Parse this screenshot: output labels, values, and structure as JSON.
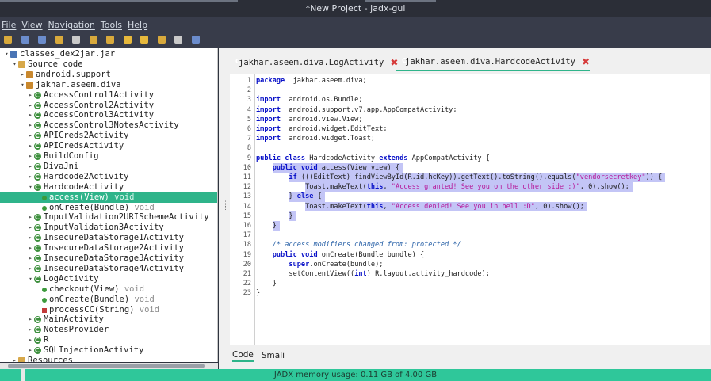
{
  "window": {
    "title": "*New Project - jadx-gui"
  },
  "menu": [
    "File",
    "View",
    "Navigation",
    "Tools",
    "Help"
  ],
  "toolbar": {
    "icons": [
      {
        "name": "open-file-icon",
        "color": "#d8a93c"
      },
      {
        "name": "add-files-icon",
        "color": "#6b8ccc"
      },
      {
        "name": "save-all-icon",
        "color": "#6b8ccc"
      },
      {
        "name": "sync-tree-icon",
        "color": "#d8a93c"
      },
      {
        "name": "flatten-packages-icon",
        "color": "#c9c9c9"
      },
      {
        "name": "text-search-icon",
        "color": "#d8a93c"
      },
      {
        "name": "class-search-icon",
        "color": "#d8a93c"
      },
      {
        "name": "back-icon",
        "color": "#e6b83c"
      },
      {
        "name": "forward-icon",
        "color": "#e6b83c"
      },
      {
        "name": "decompile-all-icon",
        "color": "#d8a93c"
      },
      {
        "name": "log-viewer-icon",
        "color": "#c9c9c9"
      },
      {
        "name": "preferences-icon",
        "color": "#6b8ccc"
      }
    ]
  },
  "tree": {
    "rows": [
      {
        "label": "classes_dex2jar.jar",
        "indent": 0,
        "arrow": "▾",
        "icon": "jar"
      },
      {
        "label": "Source code",
        "indent": 1,
        "arrow": "▾",
        "icon": "folder"
      },
      {
        "label": "android.support",
        "indent": 2,
        "arrow": "▸",
        "icon": "pkg"
      },
      {
        "label": "jakhar.aseem.diva",
        "indent": 2,
        "arrow": "▾",
        "icon": "pkg"
      },
      {
        "label": "AccessControl1Activity",
        "indent": 3,
        "arrow": "▸",
        "icon": "class"
      },
      {
        "label": "AccessControl2Activity",
        "indent": 3,
        "arrow": "▸",
        "icon": "class"
      },
      {
        "label": "AccessControl3Activity",
        "indent": 3,
        "arrow": "▸",
        "icon": "class"
      },
      {
        "label": "AccessControl3NotesActivity",
        "indent": 3,
        "arrow": "▸",
        "icon": "class"
      },
      {
        "label": "APICreds2Activity",
        "indent": 3,
        "arrow": "▸",
        "icon": "class"
      },
      {
        "label": "APICredsActivity",
        "indent": 3,
        "arrow": "▸",
        "icon": "class"
      },
      {
        "label": "BuildConfig",
        "indent": 3,
        "arrow": "▸",
        "icon": "class"
      },
      {
        "label": "DivaJni",
        "indent": 3,
        "arrow": "▸",
        "icon": "class"
      },
      {
        "label": "Hardcode2Activity",
        "indent": 3,
        "arrow": "▸",
        "icon": "class"
      },
      {
        "label": "HardcodeActivity",
        "indent": 3,
        "arrow": "▾",
        "icon": "class"
      },
      {
        "label": "access(View)",
        "rtype": "void",
        "indent": 4,
        "arrow": "",
        "icon": "method",
        "selected": true
      },
      {
        "label": "onCreate(Bundle)",
        "rtype": "void",
        "indent": 4,
        "arrow": "",
        "icon": "method"
      },
      {
        "label": "InputValidation2URISchemeActivity",
        "indent": 3,
        "arrow": "▸",
        "icon": "class"
      },
      {
        "label": "InputValidation3Activity",
        "indent": 3,
        "arrow": "▸",
        "icon": "class"
      },
      {
        "label": "InsecureDataStorage1Activity",
        "indent": 3,
        "arrow": "▸",
        "icon": "class"
      },
      {
        "label": "InsecureDataStorage2Activity",
        "indent": 3,
        "arrow": "▸",
        "icon": "class"
      },
      {
        "label": "InsecureDataStorage3Activity",
        "indent": 3,
        "arrow": "▸",
        "icon": "class"
      },
      {
        "label": "InsecureDataStorage4Activity",
        "indent": 3,
        "arrow": "▸",
        "icon": "class"
      },
      {
        "label": "LogActivity",
        "indent": 3,
        "arrow": "▾",
        "icon": "class"
      },
      {
        "label": "checkout(View)",
        "rtype": "void",
        "indent": 4,
        "arrow": "",
        "icon": "method"
      },
      {
        "label": "onCreate(Bundle)",
        "rtype": "void",
        "indent": 4,
        "arrow": "",
        "icon": "method"
      },
      {
        "label": "processCC(String)",
        "rtype": "void",
        "indent": 4,
        "arrow": "",
        "icon": "method-priv"
      },
      {
        "label": "MainActivity",
        "indent": 3,
        "arrow": "▸",
        "icon": "class"
      },
      {
        "label": "NotesProvider",
        "indent": 3,
        "arrow": "▸",
        "icon": "class"
      },
      {
        "label": "R",
        "indent": 3,
        "arrow": "▸",
        "icon": "class"
      },
      {
        "label": "SQLInjectionActivity",
        "indent": 3,
        "arrow": "▸",
        "icon": "class"
      },
      {
        "label": "Resources",
        "indent": 1,
        "arrow": "▸",
        "icon": "folder"
      }
    ]
  },
  "editor": {
    "tabs": [
      {
        "label": "jakhar.aseem.diva.LogActivity",
        "active": false
      },
      {
        "label": "jakhar.aseem.diva.HardcodeActivity",
        "active": true
      }
    ],
    "bottom_tabs": [
      {
        "label": "Code",
        "active": true
      },
      {
        "label": "Smali",
        "active": false
      }
    ],
    "lines": [
      {
        "n": "1",
        "t": [
          [
            "kw",
            "package"
          ],
          [
            "",
            "  jakhar.aseem.diva;"
          ]
        ]
      },
      {
        "n": "2",
        "t": []
      },
      {
        "n": "3",
        "t": [
          [
            "kw",
            "import"
          ],
          [
            "",
            "  android.os.Bundle;"
          ]
        ]
      },
      {
        "n": "4",
        "t": [
          [
            "kw",
            "import"
          ],
          [
            "",
            "  android.support.v7.app.AppCompatActivity;"
          ]
        ]
      },
      {
        "n": "5",
        "t": [
          [
            "kw",
            "import"
          ],
          [
            "",
            "  android.view.View;"
          ]
        ]
      },
      {
        "n": "6",
        "t": [
          [
            "kw",
            "import"
          ],
          [
            "",
            "  android.widget.EditText;"
          ]
        ]
      },
      {
        "n": "7",
        "t": [
          [
            "kw",
            "import"
          ],
          [
            "",
            "  android.widget.Toast;"
          ]
        ]
      },
      {
        "n": "8",
        "t": []
      },
      {
        "n": "9",
        "t": [
          [
            "kw",
            "public class"
          ],
          [
            "",
            " HardcodeActivity "
          ],
          [
            "kw",
            "extends"
          ],
          [
            "",
            " AppCompatActivity {"
          ]
        ]
      },
      {
        "n": "10",
        "t": [
          [
            "",
            "    "
          ],
          [
            "kw",
            "public void"
          ],
          [
            "",
            " access(View view) {"
          ]
        ],
        "sel": true
      },
      {
        "n": "11",
        "t": [
          [
            "",
            "        "
          ],
          [
            "kw",
            "if"
          ],
          [
            "",
            " (((EditText) findViewById(R.id.hcKey)).getText().toString().equals("
          ],
          [
            "str",
            "\"vendorsecretkey\""
          ],
          [
            "",
            ")) {"
          ]
        ],
        "sel": true
      },
      {
        "n": "12",
        "t": [
          [
            "",
            "            Toast.makeText("
          ],
          [
            "kw",
            "this"
          ],
          [
            "",
            ", "
          ],
          [
            "str",
            "\"Access granted! See you on the other side :)\""
          ],
          [
            "",
            ", 0).show();"
          ]
        ],
        "sel": true
      },
      {
        "n": "13",
        "t": [
          [
            "",
            "        } "
          ],
          [
            "kw",
            "else"
          ],
          [
            "",
            " {"
          ]
        ],
        "sel": true
      },
      {
        "n": "14",
        "t": [
          [
            "",
            "            Toast.makeText("
          ],
          [
            "kw",
            "this"
          ],
          [
            "",
            ", "
          ],
          [
            "str",
            "\"Access denied! See you in hell :D\""
          ],
          [
            "",
            ", 0).show();"
          ]
        ],
        "sel": true
      },
      {
        "n": "15",
        "t": [
          [
            "",
            "        }"
          ]
        ],
        "sel": true
      },
      {
        "n": "16",
        "t": [
          [
            "",
            "    }"
          ]
        ],
        "sel": true
      },
      {
        "n": "17",
        "t": []
      },
      {
        "n": "18",
        "t": [
          [
            "",
            "    "
          ],
          [
            "cmt",
            "/* access modifiers changed from: protected */"
          ]
        ]
      },
      {
        "n": "19",
        "t": [
          [
            "",
            "    "
          ],
          [
            "kw",
            "public void"
          ],
          [
            "",
            " onCreate(Bundle bundle) {"
          ]
        ]
      },
      {
        "n": "20",
        "t": [
          [
            "",
            "        "
          ],
          [
            "kw",
            "super"
          ],
          [
            "",
            ".onCreate(bundle);"
          ]
        ]
      },
      {
        "n": "21",
        "t": [
          [
            "",
            "        setContentView(("
          ],
          [
            "kw",
            "int"
          ],
          [
            "",
            ") R.layout.activity_hardcode);"
          ]
        ]
      },
      {
        "n": "22",
        "t": [
          [
            "",
            "    }"
          ]
        ]
      },
      {
        "n": "23",
        "t": [
          [
            "",
            "}"
          ]
        ]
      }
    ]
  },
  "status": {
    "text": "JADX memory usage: 0.11 GB of 4.00 GB"
  },
  "colors": {
    "accent": "#2fb48a",
    "statusbar": "#2fc79a",
    "selection": "#c3c5f6"
  }
}
